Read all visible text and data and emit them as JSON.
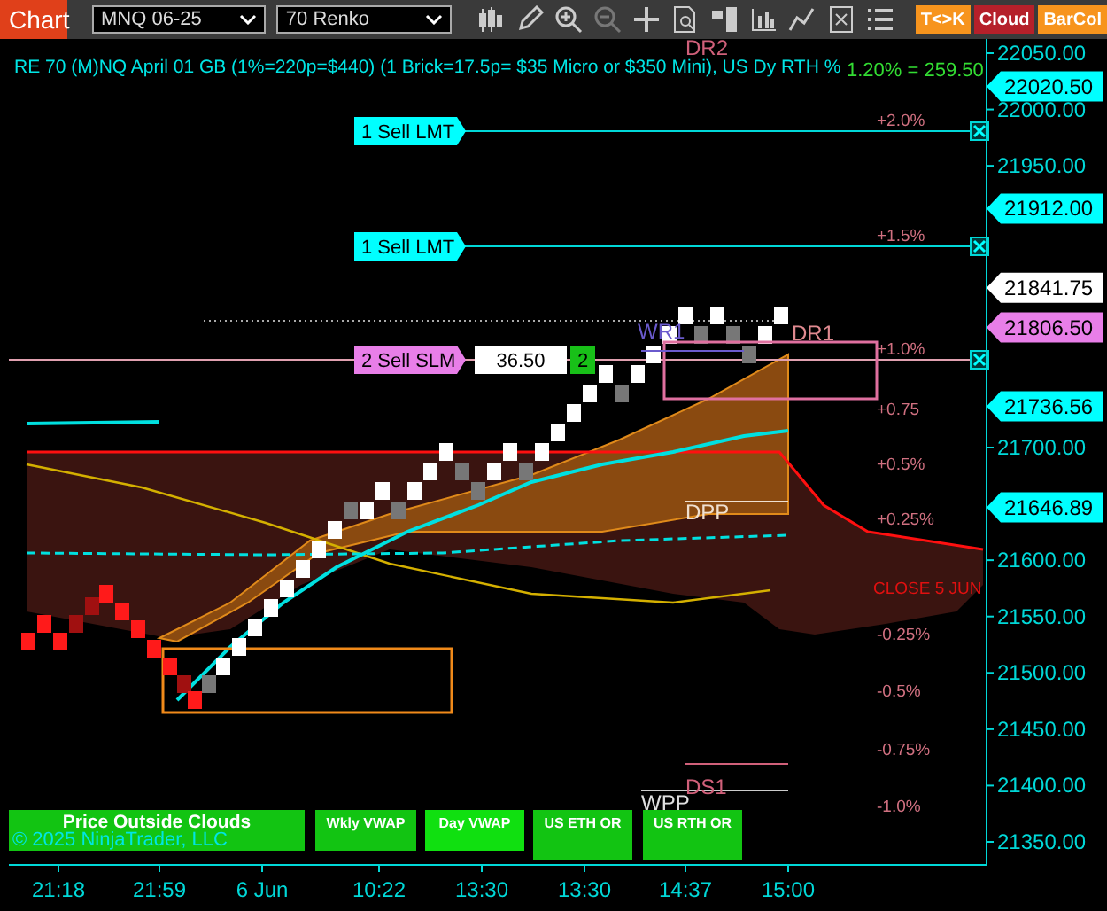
{
  "toolbar": {
    "title": "Chart",
    "instrument": "MNQ 06-25",
    "bar_type": "70 Renko",
    "toggles": [
      {
        "label": "T<>K",
        "color": "#f7941d"
      },
      {
        "label": "Cloud",
        "color": "#b5202a"
      },
      {
        "label": "BarCol",
        "color": "#f7941d"
      }
    ]
  },
  "chart": {
    "header": "RE 70 (M)NQ April 01 GB (1%=220p=$440) (1 Brick=17.5p= $35 Micro or $350 Mini), US Dy RTH %",
    "readout": "1.20% = 259.50",
    "price_ticks": [
      "22050.00",
      "22000.00",
      "21950.00",
      "21700.00",
      "21600.00",
      "21550.00",
      "21500.00",
      "21450.00",
      "21400.00",
      "21350.00"
    ],
    "time_ticks": [
      "21:18",
      "21:59",
      "6 Jun",
      "10:22",
      "13:30",
      "13:30",
      "14:37",
      "15:00"
    ],
    "price_markers": [
      {
        "value": "22020.50",
        "kind": "order"
      },
      {
        "value": "21912.00",
        "kind": "order"
      },
      {
        "value": "21841.75",
        "kind": "last"
      },
      {
        "value": "21806.50",
        "kind": "stop"
      },
      {
        "value": "21736.56",
        "kind": "indicator"
      },
      {
        "value": "21646.89",
        "kind": "indicator"
      }
    ],
    "orders": [
      {
        "label": "1 Sell LMT",
        "kind": "limit"
      },
      {
        "label": "1 Sell LMT",
        "kind": "limit"
      },
      {
        "label": "2 Sell SLM",
        "kind": "stop",
        "price": "36.50",
        "quantity": "2"
      }
    ],
    "percent_levels": [
      "+2.0%",
      "+1.5%",
      "+1.0%",
      "+0.75",
      "+0.5%",
      "+0.25%",
      "-0.25%",
      "-0.5%",
      "-0.75%",
      "-1.0%"
    ],
    "pivot_labels": [
      {
        "label": "DR2",
        "color": "#d0607a"
      },
      {
        "label": "WR1",
        "color": "#6a5acd"
      },
      {
        "label": "DR1",
        "color": "#e08a90"
      },
      {
        "label": "DPP",
        "color": "#f0e0d0"
      },
      {
        "label": "DS1",
        "color": "#d0607a"
      },
      {
        "label": "WPP",
        "color": "#e0e0e0"
      }
    ],
    "close_label": "CLOSE 5 JUN",
    "indicator_buttons": [
      "Price Outside Clouds",
      "Wkly VWAP",
      "Day VWAP",
      "US ETH OR",
      "US RTH OR"
    ],
    "copyright": "© 2025 NinjaTrader, LLC"
  }
}
